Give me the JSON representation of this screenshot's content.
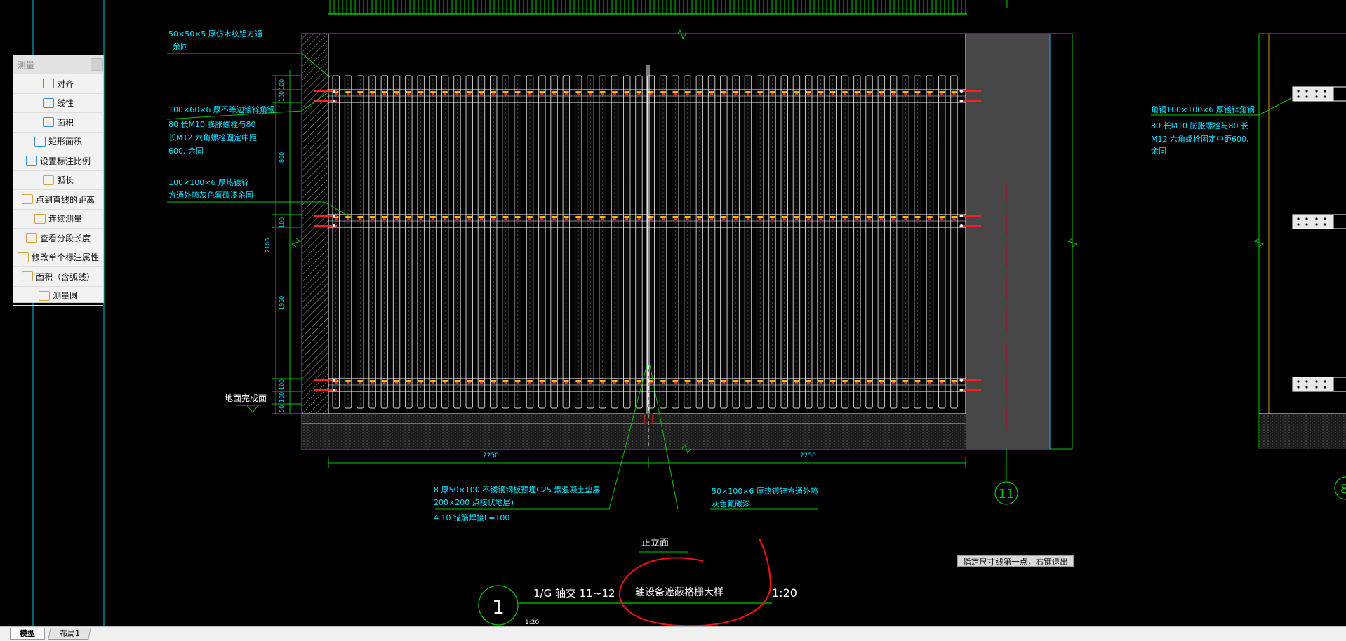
{
  "colors": {
    "background": "#000000",
    "cyan_text": "#00e5ff",
    "green_line": "#00d000",
    "white_line": "#ffffff",
    "red_bolt": "#ff2020",
    "yellow_mark": "#e0c000",
    "dark_slot": "#4a4a4a",
    "highlight_circle": "#ff1010"
  },
  "palette": {
    "title": "测量",
    "items": [
      {
        "label": "对齐",
        "icon": "align-dimension-icon"
      },
      {
        "label": "线性",
        "icon": "linear-dimension-icon"
      },
      {
        "label": "面积",
        "icon": "area-icon"
      },
      {
        "label": "矩形面积",
        "icon": "rect-area-icon"
      },
      {
        "label": "设置标注比例",
        "icon": "dimension-scale-icon"
      },
      {
        "label": "弧长",
        "icon": "arc-length-icon"
      },
      {
        "label": "点到直线的距离",
        "icon": "point-line-distance-icon"
      },
      {
        "label": "连续测量",
        "icon": "continuous-measure-icon"
      },
      {
        "label": "查看分段长度",
        "icon": "segment-length-icon"
      },
      {
        "label": "修改单个标注属性",
        "icon": "edit-dimension-icon"
      },
      {
        "label": "面积（含弧线）",
        "icon": "arc-area-icon"
      },
      {
        "label": "测量圆",
        "icon": "measure-circle-icon"
      }
    ]
  },
  "annotations": {
    "left_1_line1": "50×50×5    厚仿木纹铝方通",
    "left_1_line2": "余同",
    "left_2_line1": "100×60×6    厚不等边镀锌角钢",
    "left_2_line2": "80  长M10    膨胀螺栓与80",
    "left_2_line3": "长M12    六角螺栓固定中距",
    "left_2_line4": "600,   余同",
    "left_3_line1": "100×100×6      厚热镀锌",
    "left_3_line2": "方通外喷灰色氟碳漆余同",
    "ground": "地面完成面",
    "right_line1": "角钢100×100×6      厚镀锌角钢",
    "right_line2": "80  长M10    膨胀螺栓与80    长",
    "right_line3": "M12    六角螺栓固定中距600,",
    "right_line4": "余同",
    "bottom_1_line1": "8 厚50×100     不锈钢钢板预埋C25    素混凝土垫层",
    "bottom_1_line2": "200×200      点接伏地层)",
    "bottom_1_line3": "4     10   锚筋焊接L=100",
    "bottom_2_line1": "50×100×6      厚热镀锌方通外喷",
    "bottom_2_line2": "灰色氟碳漆"
  },
  "dimensions": {
    "v1": "100",
    "v2": "100",
    "v3": "800",
    "v4": "100",
    "v_total": "2100",
    "v5": "1950",
    "v6": "100",
    "v7": "100",
    "v8": "50",
    "v9": "100",
    "h_left": "2250",
    "h_right": "2250"
  },
  "view_title": "正立面",
  "grid_bubble_11": "11",
  "grid_bubble_8": "8",
  "detail": {
    "number": "1",
    "axis": "1/G    轴交     11~12",
    "name": "轴设备遮蔽格栅大样",
    "scale": "1:20",
    "small_scale": "1:20"
  },
  "command_prompt": "指定尺寸线第一点，右键退出",
  "tabs": {
    "model": "模型",
    "layout1": "布局1"
  }
}
